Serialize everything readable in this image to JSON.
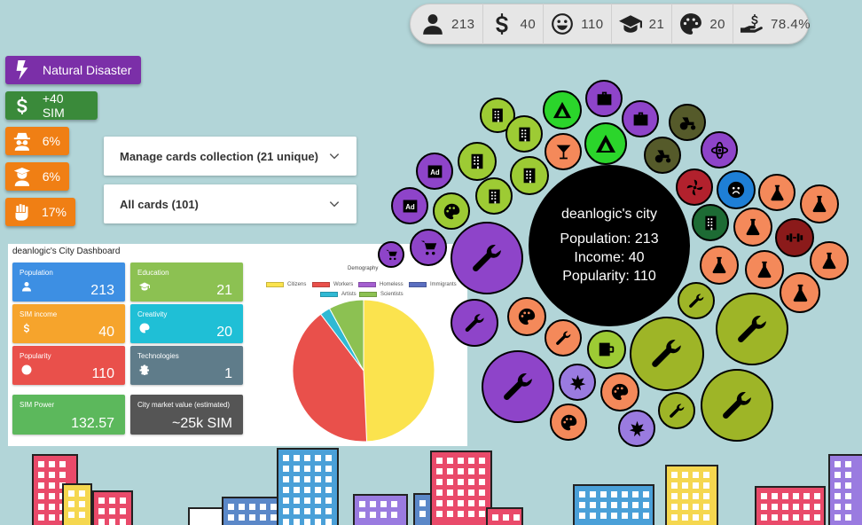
{
  "stats": [
    {
      "icon": "person-icon",
      "value": "213"
    },
    {
      "icon": "dollar-icon",
      "value": "40"
    },
    {
      "icon": "smile-icon",
      "value": "110"
    },
    {
      "icon": "graduation-cap-icon",
      "value": "21"
    },
    {
      "icon": "palette-icon",
      "value": "20"
    },
    {
      "icon": "hand-money-icon",
      "value": "78.4%"
    }
  ],
  "actions": [
    {
      "label": "Natural Disaster",
      "icon": "lightning-icon",
      "color": "#7b2fa8"
    },
    {
      "label": "+40 SIM",
      "icon": "dollar-icon",
      "color": "#3a8a3a"
    },
    {
      "label": "6%",
      "icon": "spy-icon",
      "color": "#f07f14"
    },
    {
      "label": "6%",
      "icon": "graduate-icon",
      "color": "#f07f14"
    },
    {
      "label": "17%",
      "icon": "fist-icon",
      "color": "#f07f14"
    }
  ],
  "panels": {
    "collection": "Manage cards collection (21 unique)",
    "all_cards": "All cards (101)"
  },
  "dashboard": {
    "title": "deanlogic's City Dashboard",
    "tiles": {
      "population": {
        "label": "Population",
        "value": "213",
        "color": "#3d8fe3"
      },
      "education": {
        "label": "Education",
        "value": "21",
        "color": "#8cc152"
      },
      "sim_income": {
        "label": "SIM income",
        "value": "40",
        "color": "#f6a42c"
      },
      "creativity": {
        "label": "Creativity",
        "value": "20",
        "color": "#1fbfd6"
      },
      "popularity": {
        "label": "Popularity",
        "value": "110",
        "color": "#e9504b"
      },
      "technologies": {
        "label": "Technologies",
        "value": "1",
        "color": "#5f7c8a"
      },
      "sim_power": {
        "label": "SIM Power",
        "value": "132.57",
        "color": "#5cb85c"
      },
      "market_value": {
        "label": "City market value (estimated)",
        "value": "~25k SIM",
        "color": "#555555"
      }
    },
    "chart_data": {
      "type": "pie",
      "title": "Demography",
      "categories": [
        "Citizens",
        "Workers",
        "Homeless",
        "Immigrants",
        "Artists",
        "Scientists"
      ],
      "values": [
        105,
        86,
        0,
        0,
        5,
        17
      ],
      "colors": [
        "#fbe34e",
        "#e9504b",
        "#a55fd0",
        "#5b6fc0",
        "#30b9d4",
        "#8cc152"
      ]
    }
  },
  "city": {
    "name": "deanlogic's city",
    "population": "Population: 213",
    "income": "Income: 40",
    "popularity": "Popularity: 110"
  },
  "colors": {
    "background": "#b2d5d8",
    "lime": "#9dcb34",
    "purple": "#8e44c9",
    "orange": "#f4895a",
    "green": "#2bd52b",
    "olive": "#9eb527"
  }
}
